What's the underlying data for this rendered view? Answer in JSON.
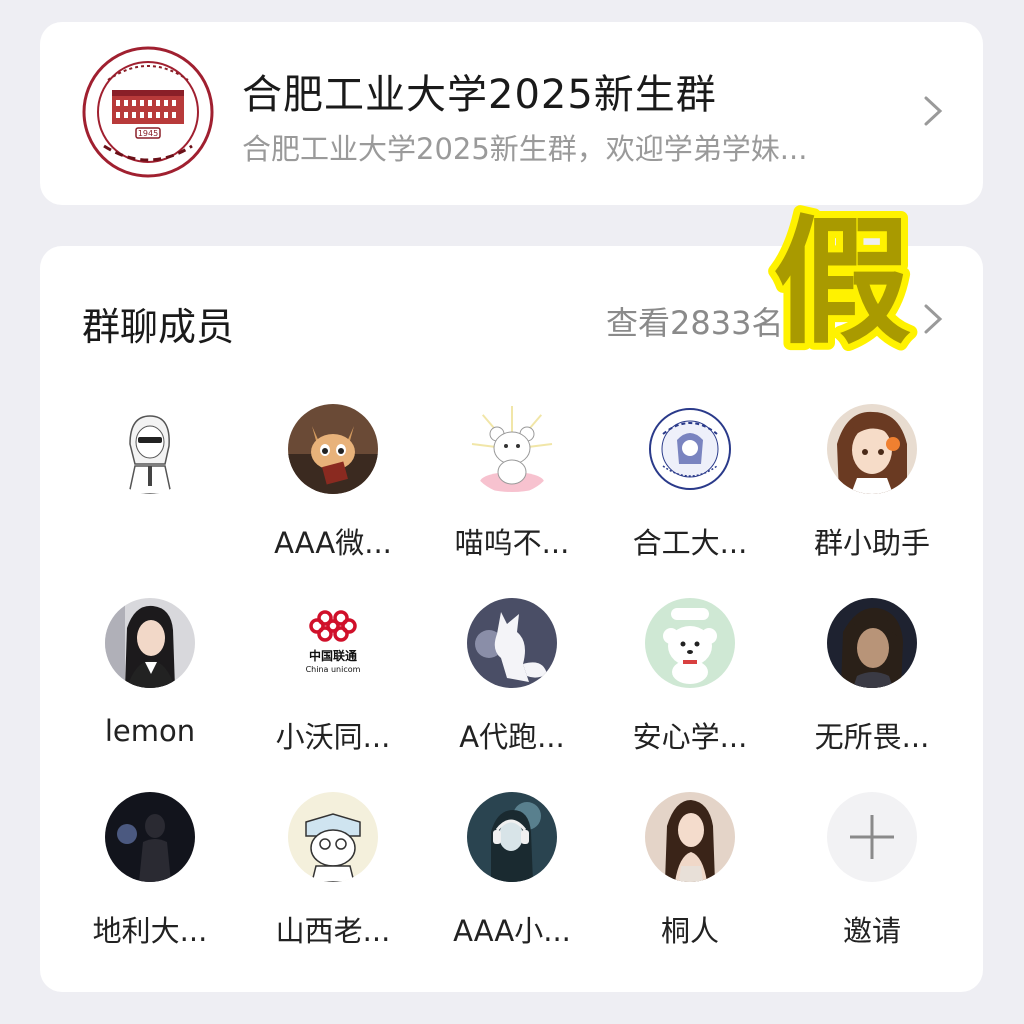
{
  "group": {
    "name": "合肥工业大学2025新生群",
    "description": "合肥工业大学2025新生群，欢迎学弟学妹...",
    "logo_icon": "university-seal-icon",
    "logo_year": "1945"
  },
  "members_section": {
    "title": "群聊成员",
    "view_all": "查看2833名"
  },
  "stamp": {
    "text": "假",
    "fill": "#a99a00",
    "outline": "#fff200"
  },
  "members": [
    {
      "name": "",
      "avatar": "anime-sunglasses-avatar"
    },
    {
      "name": "AAA微...",
      "avatar": "cat-avatar"
    },
    {
      "name": "喵呜不...",
      "avatar": "bear-avatar"
    },
    {
      "name": "合工大...",
      "avatar": "university-badge-avatar"
    },
    {
      "name": "群小助手",
      "avatar": "anime-girl-avatar"
    },
    {
      "name": "lemon",
      "avatar": "woman-photo-avatar"
    },
    {
      "name": "小沃同...",
      "avatar": "china-unicom-avatar"
    },
    {
      "name": "A代跑...",
      "avatar": "fox-avatar"
    },
    {
      "name": "安心学...",
      "avatar": "white-dog-avatar"
    },
    {
      "name": "无所畏...",
      "avatar": "dark-anime-avatar"
    },
    {
      "name": "地利大...",
      "avatar": "night-figure-avatar"
    },
    {
      "name": "山西老...",
      "avatar": "cartoon-book-avatar"
    },
    {
      "name": "AAA小...",
      "avatar": "headphones-girl-avatar"
    },
    {
      "name": "桐人",
      "avatar": "woman-portrait-avatar"
    },
    {
      "name": "邀请",
      "avatar": "plus-icon"
    }
  ],
  "unicom": {
    "cn": "中国联通",
    "en": "China unicom"
  }
}
